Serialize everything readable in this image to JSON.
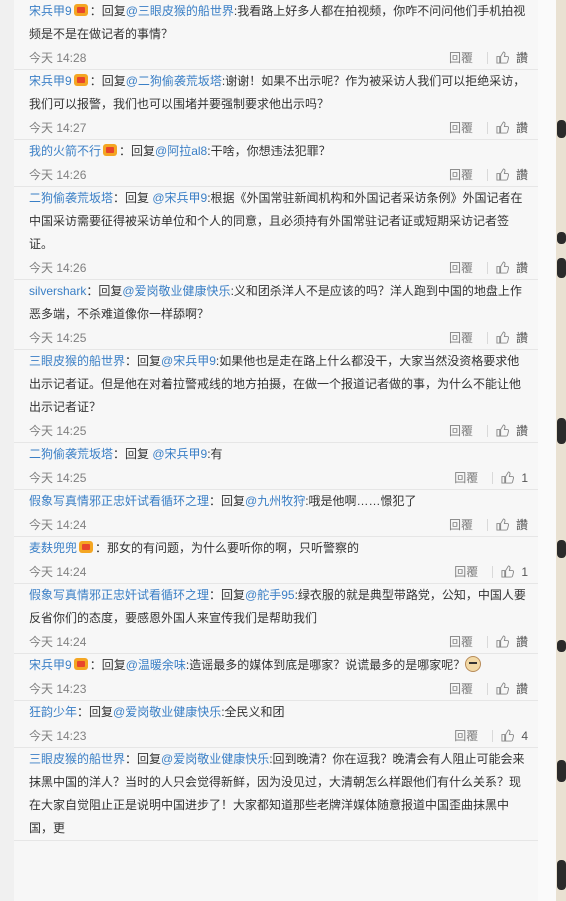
{
  "top_fragment": {
    "reply_label": "回覆",
    "like_label": "讚"
  },
  "comments": [
    {
      "user": "宋兵甲9",
      "has_badge": true,
      "prefix": "：回复",
      "mention": "@三眼皮猴的船世界",
      "body": ":我看路上好多人都在拍视频，你咋不问问他们手机拍视频是不是在做记者的事情？",
      "time": "今天 14:28",
      "reply": "回覆",
      "like": "讚"
    },
    {
      "user": "宋兵甲9",
      "has_badge": true,
      "prefix": "：回复",
      "mention": "@二狗偷袭荒坂塔",
      "body": ":谢谢！如果不出示呢？作为被采访人我们可以拒绝采访，我们可以报警，我们也可以围堵并要强制要求他出示吗？",
      "time": "今天 14:27",
      "reply": "回覆",
      "like": "讚"
    },
    {
      "user": "我的火箭不行",
      "has_badge": true,
      "prefix": "：回复",
      "mention": "@阿拉al8",
      "body": ":干啥，你想违法犯罪？",
      "time": "今天 14:26",
      "reply": "回覆",
      "like": "讚"
    },
    {
      "user": "二狗偷袭荒坂塔",
      "has_badge": false,
      "prefix": "：回复 ",
      "mention": "@宋兵甲9",
      "body": ":根据《外国常驻新闻机构和外国记者采访条例》外国记者在中国采访需要征得被采访单位和个人的同意，且必须持有外国常驻记者证或短期采访记者签证。",
      "time": "今天 14:26",
      "reply": "回覆",
      "like": "讚"
    },
    {
      "user": "silvershark",
      "has_badge": false,
      "prefix": "：回复",
      "mention": "@爱岗敬业健康快乐",
      "body": ":义和团杀洋人不是应该的吗？洋人跑到中国的地盘上作恶多端，不杀难道像你一样舔啊？",
      "time": "今天 14:25",
      "reply": "回覆",
      "like": "讚"
    },
    {
      "user": "三眼皮猴的船世界",
      "has_badge": false,
      "prefix": "：回复",
      "mention": "@宋兵甲9",
      "body": ":如果他也是走在路上什么都没干，大家当然没资格要求他出示记者证。但是他在对着拉警戒线的地方拍摄，在做一个报道记者做的事，为什么不能让他出示记者证？",
      "time": "今天 14:25",
      "reply": "回覆",
      "like": "讚"
    },
    {
      "user": "二狗偷袭荒坂塔",
      "has_badge": false,
      "prefix": "：回复 ",
      "mention": "@宋兵甲9",
      "body": ":有",
      "time": "今天 14:25",
      "reply": "回覆",
      "like": "1"
    },
    {
      "user": "假象写真情邪正忠奸试看循环之理",
      "has_badge": false,
      "prefix": "：回复",
      "mention": "@九州牧狩",
      "body": ":哦是他啊……憬犯了",
      "time": "今天 14:24",
      "reply": "回覆",
      "like": "讚"
    },
    {
      "user": "麦麸兜兜",
      "has_badge": true,
      "prefix": "：",
      "mention": "",
      "body": "那女的有问题，为什么要听你的啊，只听警察的",
      "time": "今天 14:24",
      "reply": "回覆",
      "like": "1"
    },
    {
      "user": "假象写真情邪正忠奸试看循环之理",
      "has_badge": false,
      "prefix": "：回复",
      "mention": "@舵手95",
      "body": ":绿衣服的就是典型带路党，公知，中国人要反省你们的态度，要感恩外国人来宣传我们是帮助我们",
      "time": "今天 14:24",
      "reply": "回覆",
      "like": "讚"
    },
    {
      "user": "宋兵甲9",
      "has_badge": true,
      "prefix": "：回复",
      "mention": "@温暖余味",
      "body": ":造谣最多的媒体到底是哪家？说谎最多的是哪家呢？",
      "has_emoji": true,
      "time": "今天 14:23",
      "reply": "回覆",
      "like": "讚"
    },
    {
      "user": "狂韵少年",
      "has_badge": false,
      "prefix": "：回复",
      "mention": "@爱岗敬业健康快乐",
      "body": ":全民义和团",
      "time": "今天 14:23",
      "reply": "回覆",
      "like": "4"
    },
    {
      "user": "三眼皮猴的船世界",
      "has_badge": false,
      "prefix": "：回复",
      "mention": "@爱岗敬业健康快乐",
      "body": ":回到晚清？你在逗我？晚清会有人阻止可能会来抹黑中国的洋人？当时的人只会觉得新鲜，因为没见过，大清朝怎么样跟他们有什么关系？现在大家自觉阻止正是说明中国进步了！大家都知道那些老牌洋媒体随意报道中国歪曲抹黑中国，更",
      "time": "",
      "reply": "",
      "like": ""
    }
  ]
}
